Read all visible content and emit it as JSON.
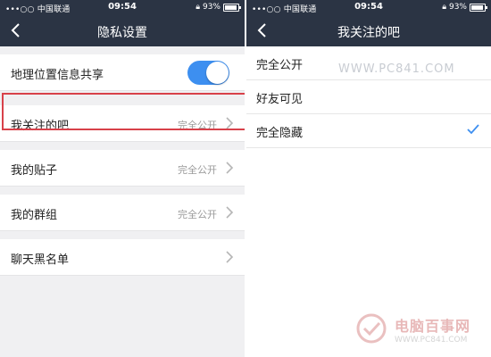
{
  "status_bar": {
    "carrier": "•••○○ 中国联通",
    "time": "09:54",
    "battery": "93%",
    "battery_level": 0.93
  },
  "left": {
    "title": "隐私设置",
    "location_share": {
      "label": "地理位置信息共享",
      "enabled": true
    },
    "rows": [
      {
        "label": "我关注的吧",
        "value": "完全公开"
      },
      {
        "label": "我的贴子",
        "value": "完全公开"
      },
      {
        "label": "我的群组",
        "value": "完全公开"
      },
      {
        "label": "聊天黑名单",
        "value": ""
      }
    ],
    "highlight_color": "#d8414a"
  },
  "right": {
    "title": "我关注的吧",
    "options": [
      {
        "label": "完全公开",
        "selected": false
      },
      {
        "label": "好友可见",
        "selected": false
      },
      {
        "label": "完全隐藏",
        "selected": true
      }
    ],
    "watermark": "WWW.PC841.COM"
  },
  "logo": {
    "name": "电脑百事网",
    "url": "WWW.PC841.COM"
  },
  "colors": {
    "nav_bg": "#2b3444",
    "toggle_on": "#3d8ff0",
    "check": "#3d8ff0"
  }
}
